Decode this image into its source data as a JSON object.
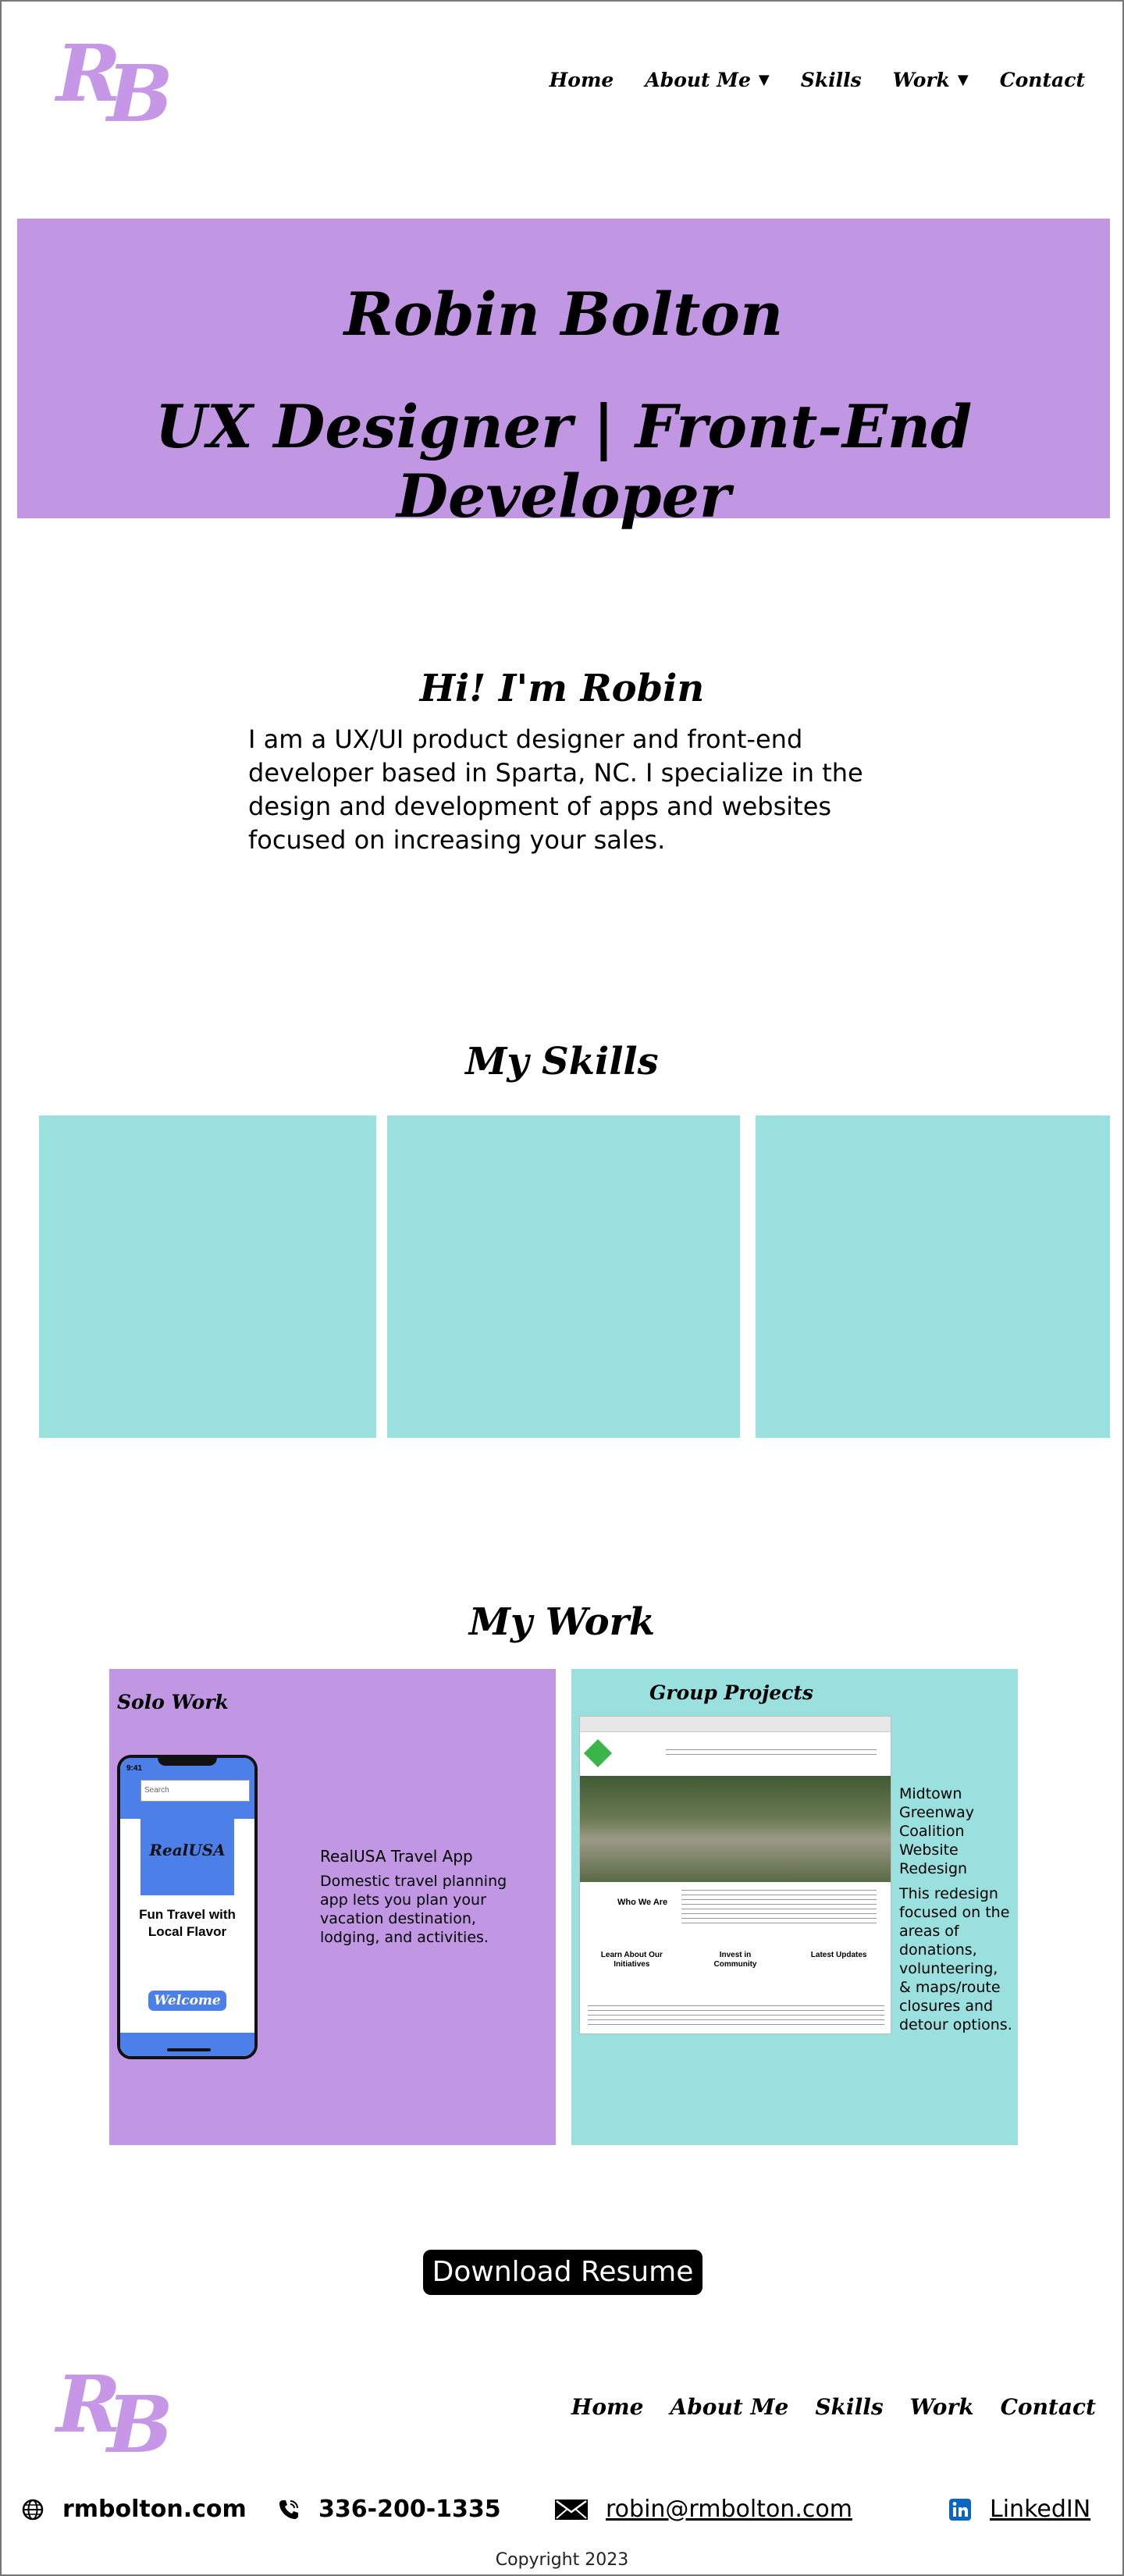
{
  "header": {
    "logo": "RB",
    "logo_letter_1": "R",
    "logo_letter_2": "B",
    "nav": [
      {
        "label": "Home",
        "dropdown": false
      },
      {
        "label": "About Me",
        "dropdown": true
      },
      {
        "label": "Skills",
        "dropdown": false
      },
      {
        "label": "Work",
        "dropdown": true
      },
      {
        "label": "Contact",
        "dropdown": false
      }
    ],
    "caret": "▼"
  },
  "hero": {
    "name": "Robin Bolton",
    "title": "UX Designer | Front-End Developer",
    "background": "#c197e3"
  },
  "intro": {
    "heading": "Hi! I'm Robin",
    "text": "I am a UX/UI product designer and front-end developer based in Sparta, NC. I specialize in the design and development of apps and websites focused on increasing your sales."
  },
  "skills": {
    "heading": "My Skills",
    "box_color": "#99e0de"
  },
  "work": {
    "heading": "My Work",
    "solo": {
      "label": "Solo Work",
      "phone": {
        "time": "9:41",
        "search_placeholder": "Search",
        "logo_text": "RealUSA",
        "tagline": "Fun Travel with Local Flavor",
        "welcome_button": "Welcome"
      },
      "project_title": "RealUSA Travel App",
      "project_desc": "Domestic travel planning app lets you plan your vacation destination, lodging, and activities."
    },
    "group": {
      "label": "Group Projects",
      "screenshot": {
        "who_we_are": "Who We Are",
        "col1": "Learn About Our Initiatives",
        "col2": "Invest in Community",
        "col3": "Latest Updates"
      },
      "project_title": "Midtown Greenway Coalition Website Redesign",
      "project_desc": "This redesign focused on the areas of donations, volunteering, & maps/route closures and detour options."
    }
  },
  "resume_button": "Download Resume",
  "footer": {
    "nav": [
      "Home",
      "About Me",
      "Skills",
      "Work",
      "Contact"
    ],
    "website": "rmbolton.com",
    "phone": "336-200-1335",
    "email": "robin@rmbolton.com",
    "linkedin": "LinkedIN",
    "copyright": "Copyright 2023"
  },
  "colors": {
    "accent_purple": "#c197e3",
    "accent_teal": "#99e0de",
    "logo_purple": "#c597e6",
    "app_blue": "#4c7fe8",
    "linkedin_blue": "#0a66c2"
  }
}
